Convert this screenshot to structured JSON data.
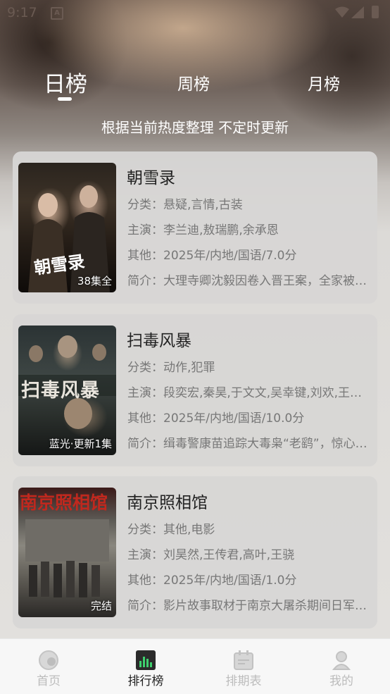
{
  "status_bar": {
    "time": "9:17",
    "notification_icon": "A"
  },
  "tabs": [
    {
      "label": "日榜",
      "active": true
    },
    {
      "label": "周榜",
      "active": false
    },
    {
      "label": "月榜",
      "active": false
    }
  ],
  "subtitle": "根据当前热度整理 不定时更新",
  "items": [
    {
      "title": "朝雪录",
      "poster_badge": "38集全",
      "poster_text": "朝雪录",
      "category": "分类：悬疑,言情,古装",
      "cast": "主演：李兰迪,敖瑞鹏,余承恩",
      "other": "其他：2025年/内地/国语/7.0分",
      "intro": "简介：大理寺卿沈毅因卷入晋王案，全家被下狱流放"
    },
    {
      "title": "扫毒风暴",
      "poster_badge": "蓝光·更新1集",
      "poster_text": "扫毒风暴",
      "category": "分类：动作,犯罪",
      "cast": "主演：段奕宏,秦昊,于文文,吴幸键,刘欢,王劲松",
      "other": "其他：2025年/内地/国语/10.0分",
      "intro": "简介：缉毒警康苗追踪大毒枭“老鹞”，惊心动魄"
    },
    {
      "title": "南京照相馆",
      "poster_badge": "完结",
      "poster_text": "南京照相馆",
      "category": "分类：其他,电影",
      "cast": "主演：刘昊然,王传君,高叶,王骁",
      "other": "其他：2025年/内地/国语/1.0分",
      "intro": "简介：影片故事取材于南京大屠杀期间日军真实罪行"
    }
  ],
  "bottom_nav": [
    {
      "label": "首页",
      "icon": "home-icon",
      "active": false
    },
    {
      "label": "排行榜",
      "icon": "ranking-icon",
      "active": true
    },
    {
      "label": "排期表",
      "icon": "schedule-icon",
      "active": false
    },
    {
      "label": "我的",
      "icon": "profile-icon",
      "active": false
    }
  ],
  "colors": {
    "active_nav": "#222222",
    "inactive_nav": "#bcbcbc",
    "ranking_icon_accent": "#3ecf6e"
  }
}
